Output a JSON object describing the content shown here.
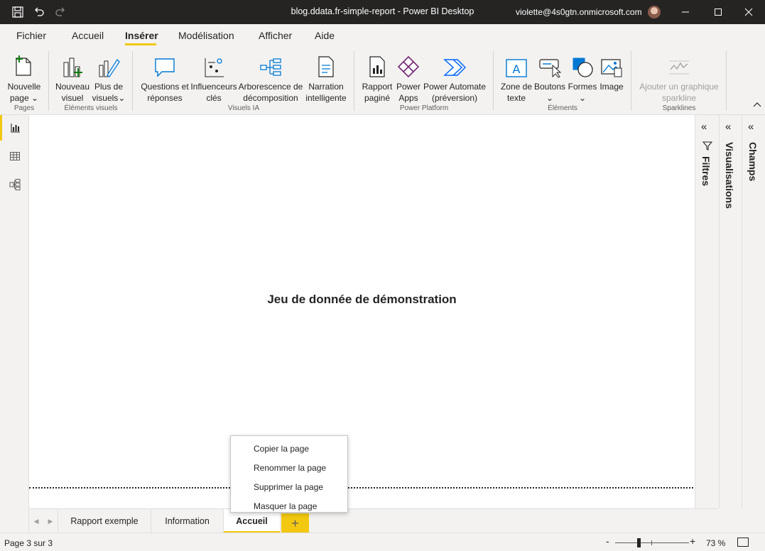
{
  "window": {
    "title": "blog.ddata.fr-simple-report - Power BI Desktop",
    "user": "violette@4s0gtn.onmicrosoft.com"
  },
  "menu": {
    "items": [
      "Fichier",
      "Accueil",
      "Insérer",
      "Modélisation",
      "Afficher",
      "Aide"
    ],
    "active": "Insérer"
  },
  "ribbon": {
    "groups": {
      "pages": "Pages",
      "visuals": "Éléments visuels",
      "ai": "Visuels IA",
      "platform": "Power Platform",
      "elements": "Éléments",
      "sparklines": "Sparklines"
    },
    "buttons": {
      "new_page": [
        "Nouvelle",
        "page"
      ],
      "new_visual": [
        "Nouveau",
        "visuel"
      ],
      "more_visuals": [
        "Plus de",
        "visuels"
      ],
      "qa": [
        "Questions et",
        "réponses"
      ],
      "key_influencers": [
        "Influenceurs",
        "clés"
      ],
      "decomp_tree": [
        "Arborescence de",
        "décomposition"
      ],
      "smart_narrative": [
        "Narration",
        "intelligente"
      ],
      "paginated": [
        "Rapport",
        "paginé"
      ],
      "power_apps": [
        "Power",
        "Apps"
      ],
      "power_automate": [
        "Power Automate",
        "(préversion)"
      ],
      "text_box": [
        "Zone de",
        "texte"
      ],
      "buttons": [
        "Boutons",
        ""
      ],
      "shapes": [
        "Formes",
        ""
      ],
      "image": [
        "Image",
        ""
      ],
      "sparkline": [
        "Ajouter un graphique",
        "sparkline"
      ]
    }
  },
  "canvas": {
    "title": "Jeu de donnée de démonstration"
  },
  "panes": {
    "filters": "Filtres",
    "visualizations": "Visualisations",
    "fields": "Champs"
  },
  "tabs": {
    "pages": [
      "Rapport exemple",
      "Information",
      "Accueil"
    ],
    "active": "Accueil",
    "add": "+"
  },
  "context_menu": {
    "items": [
      "Copier la page",
      "Renommer la page",
      "Supprimer la page",
      "Masquer la page"
    ]
  },
  "status": {
    "page": "Page 3 sur 3",
    "zoom_percent": "73 %",
    "zoom_value": 73
  },
  "colors": {
    "accent": "#f2c811",
    "titlebar": "#252423",
    "background": "#f3f2f1"
  }
}
